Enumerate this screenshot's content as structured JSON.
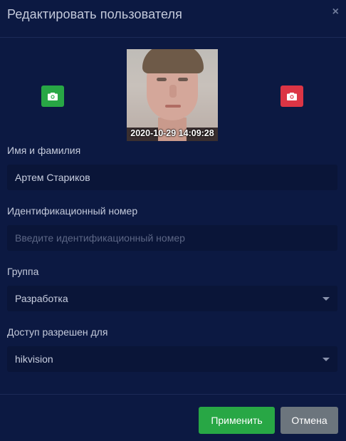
{
  "modal": {
    "title": "Редактировать пользователя",
    "close_symbol": "×"
  },
  "photo": {
    "timestamp": "2020-10-29 14:09:28",
    "left_button_icon": "camera-icon",
    "left_button_color": "#28a745",
    "right_button_icon": "camera-icon",
    "right_button_color": "#dc3545"
  },
  "fields": {
    "name": {
      "label": "Имя и фамилия",
      "value": "Артем Стариков"
    },
    "id_number": {
      "label": "Идентификационный номер",
      "value": "",
      "placeholder": "Введите идентификационный номер"
    },
    "group": {
      "label": "Группа",
      "value": "Разработка"
    },
    "access": {
      "label": "Доступ разрешен для",
      "value": "hikvision"
    }
  },
  "buttons": {
    "apply": "Применить",
    "cancel": "Отмена"
  },
  "colors": {
    "background": "#0c1942",
    "input_bg": "#0a1538",
    "apply": "#28a745",
    "cancel": "#6c757d"
  }
}
